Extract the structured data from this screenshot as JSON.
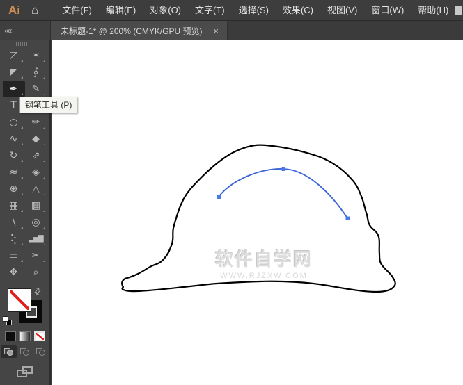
{
  "menu_bar": {
    "logo": "Ai",
    "items": [
      {
        "label": "文件(F)"
      },
      {
        "label": "编辑(E)"
      },
      {
        "label": "对象(O)"
      },
      {
        "label": "文字(T)"
      },
      {
        "label": "选择(S)"
      },
      {
        "label": "效果(C)"
      },
      {
        "label": "视图(V)"
      },
      {
        "label": "窗口(W)"
      },
      {
        "label": "帮助(H)"
      }
    ],
    "icons": {
      "home": "⌂",
      "chevron_down": "⌄",
      "collapse": "««",
      "swap": "⇄",
      "close": "×"
    }
  },
  "document_tab": {
    "title": "未标题-1* @ 200% (CMYK/GPU 预览)"
  },
  "tool_tooltip": {
    "text": "钢笔工具 (P)"
  },
  "toolbar": {
    "active_tool": "pen-tool",
    "tools": [
      {
        "name": "selection-tool",
        "glyph": "◸"
      },
      {
        "name": "magic-wand-tool",
        "glyph": "✶"
      },
      {
        "name": "direct-selection-tool",
        "glyph": "◤"
      },
      {
        "name": "lasso-tool",
        "glyph": "∮"
      },
      {
        "name": "pen-tool",
        "glyph": "✒"
      },
      {
        "name": "curvature-tool",
        "glyph": "✎"
      },
      {
        "name": "type-tool",
        "glyph": "T"
      },
      {
        "name": "line-segment-tool",
        "glyph": "╲"
      },
      {
        "name": "ellipse-tool",
        "glyph": "○"
      },
      {
        "name": "paintbrush-tool",
        "glyph": "✏"
      },
      {
        "name": "pencil-tool",
        "glyph": "∿"
      },
      {
        "name": "eraser-tool",
        "glyph": "◆"
      },
      {
        "name": "rotate-tool",
        "glyph": "↻"
      },
      {
        "name": "scale-tool",
        "glyph": "⇗"
      },
      {
        "name": "width-tool",
        "glyph": "≈"
      },
      {
        "name": "puppet-warp-tool",
        "glyph": "◈"
      },
      {
        "name": "shape-builder-tool",
        "glyph": "⊕"
      },
      {
        "name": "perspective-grid-tool",
        "glyph": "△"
      },
      {
        "name": "mesh-tool",
        "glyph": "▦"
      },
      {
        "name": "gradient-tool",
        "glyph": "▩"
      },
      {
        "name": "eyedropper-tool",
        "glyph": "∖"
      },
      {
        "name": "blend-tool",
        "glyph": "◎"
      },
      {
        "name": "symbol-sprayer-tool",
        "glyph": "⢕"
      },
      {
        "name": "column-graph-tool",
        "glyph": "▂▅▇"
      },
      {
        "name": "artboard-tool",
        "glyph": "▭"
      },
      {
        "name": "slice-tool",
        "glyph": "✂"
      },
      {
        "name": "hand-tool",
        "glyph": "✥"
      },
      {
        "name": "zoom-tool",
        "glyph": "⌕"
      }
    ],
    "color_controls": {
      "fill": "none",
      "stroke": "black",
      "selected_button": "none"
    }
  },
  "canvas": {
    "watermark_line1": "软件自学网",
    "watermark_line2": "WWW.RJZXW.COM"
  },
  "colors": {
    "path_blue": "#3a63d6",
    "anchor_blue": "#4a79ea",
    "outline_black": "#000000",
    "none_red": "#e01f1f",
    "logo_orange": "#d08e55"
  }
}
